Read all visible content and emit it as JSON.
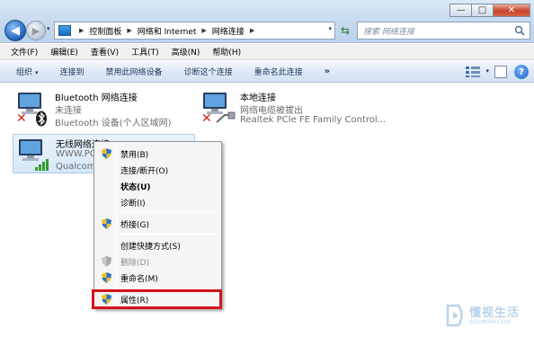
{
  "window": {
    "minimize": "—",
    "maximize": "□",
    "close": "✕"
  },
  "nav": {
    "back": "◀",
    "forward": "▶"
  },
  "address": {
    "segments": [
      "控制面板",
      "网络和 Internet",
      "网络连接"
    ]
  },
  "search": {
    "placeholder": "搜索 网络连接"
  },
  "menubar": [
    "文件(F)",
    "编辑(E)",
    "查看(V)",
    "工具(T)",
    "高级(N)",
    "帮助(H)"
  ],
  "commands": {
    "organize": "组织",
    "connect": "连接到",
    "disable": "禁用此网络设备",
    "diagnose": "诊断这个连接",
    "rename": "重命名此连接",
    "more": "»"
  },
  "connections": {
    "bluetooth": {
      "title": "Bluetooth 网络连接",
      "status": "未连接",
      "device": "Bluetooth 设备(个人区域网)"
    },
    "local": {
      "title": "本地连接",
      "status": "网络电缆被拔出",
      "device": "Realtek PCIe FE Family Control..."
    },
    "wireless": {
      "title": "无线网络连接",
      "status": "WWW.PC",
      "device": "Qualcom"
    }
  },
  "context_menu": [
    {
      "label": "禁用(B)",
      "shield": true
    },
    {
      "label": "连接/断开(O)",
      "shield": false
    },
    {
      "label": "状态(U)",
      "shield": false,
      "bold": true
    },
    {
      "label": "诊断(I)",
      "shield": false
    },
    {
      "label": "桥接(G)",
      "shield": true
    },
    {
      "label": "创建快捷方式(S)",
      "shield": false
    },
    {
      "label": "删除(D)",
      "shield": true,
      "disabled": true
    },
    {
      "label": "重命名(M)",
      "shield": true
    },
    {
      "label": "属性(R)",
      "shield": true
    }
  ],
  "watermark": {
    "text": "懂视生活",
    "sub": "SIDONSHI.COM"
  },
  "colors": {
    "highlight": "#d3141a",
    "selection": "#d6e7f8"
  }
}
